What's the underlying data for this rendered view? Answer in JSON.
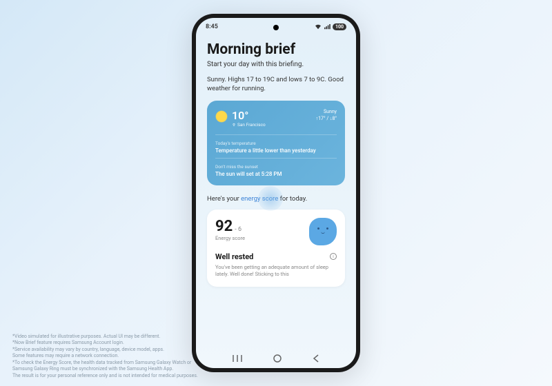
{
  "status_bar": {
    "time": "8:45",
    "battery": "100"
  },
  "page": {
    "title": "Morning brief",
    "subtitle": "Start your day with this briefing.",
    "weather_summary": "Sunny. Highs 17 to 19C and lows 7 to 9C. Good weather for running."
  },
  "weather_card": {
    "temp": "10°",
    "location": "San Francisco",
    "condition": "Sunny",
    "range": "↑17° / ↓8°",
    "today_label": "Today's temperature",
    "today_text": "Temperature a little lower than yesterday",
    "sunset_label": "Don't miss the sunset",
    "sunset_text": "The sun will set at 5:28 PM"
  },
  "energy": {
    "intro_before": "Here's your ",
    "intro_link": "energy score",
    "intro_after": " for today.",
    "score": "92",
    "delta": "- 6",
    "score_label": "Energy score",
    "rested_title": "Well rested",
    "rested_text": "You've been getting an adequate amount of sleep lately. Well done! Sticking to this"
  },
  "disclaimers": [
    "*Video simulated for illustrative purposes. Actual UI may be different.",
    "*Now Brief feature requires Samsung Account login.",
    "*Service availability may vary by country, language, device model, apps.",
    "Some features may require a network connection.",
    "*To check the Energy Score, the health data tracked from Samsung Galaxy Watch or",
    "Samsung Galaxy Ring must be synchronized with the Samsung Health App.",
    "The result is for your personal reference only and is not intended for medical purposes."
  ]
}
